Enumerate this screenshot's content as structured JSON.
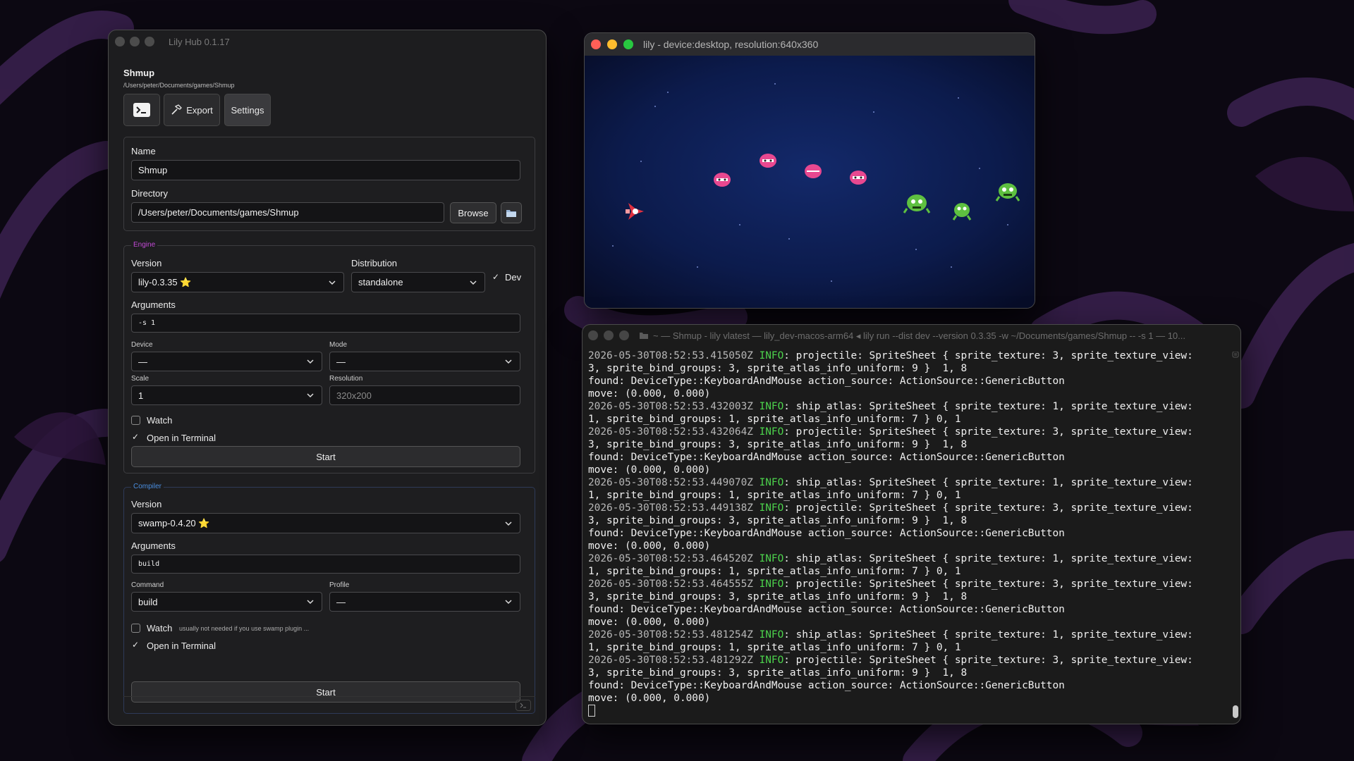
{
  "hub": {
    "title": "Lily Hub 0.1.17",
    "project_name": "Shmup",
    "project_path": "/Users/peter/Documents/games/Shmup",
    "terminal_icon": "terminal-icon",
    "export_label": "Export",
    "settings_label": "Settings",
    "general": {
      "name_label": "Name",
      "name_value": "Shmup",
      "directory_label": "Directory",
      "directory_value": "/Users/peter/Documents/games/Shmup",
      "browse_label": "Browse"
    },
    "engine": {
      "legend": "Engine",
      "legend_color": "#c34ad6",
      "version_label": "Version",
      "version_value": "lily-0.3.35 ⭐",
      "distribution_label": "Distribution",
      "distribution_value": "standalone",
      "dev_label": "Dev",
      "dev_checked": true,
      "arguments_label": "Arguments",
      "arguments_value": "-s 1",
      "device_label": "Device",
      "device_value": "—",
      "mode_label": "Mode",
      "mode_value": "—",
      "scale_label": "Scale",
      "scale_value": "1",
      "resolution_label": "Resolution",
      "resolution_placeholder": "320x200",
      "watch_label": "Watch",
      "watch_checked": false,
      "open_terminal_label": "Open in Terminal",
      "open_terminal_checked": true,
      "start_label": "Start"
    },
    "compiler": {
      "legend": "Compiler",
      "legend_color": "#4a8ee0",
      "version_label": "Version",
      "version_value": "swamp-0.4.20 ⭐",
      "arguments_label": "Arguments",
      "arguments_value": "build",
      "command_label": "Command",
      "command_value": "build",
      "profile_label": "Profile",
      "profile_value": "—",
      "watch_label": "Watch",
      "watch_hint": "usually not needed if you use swamp plugin ...",
      "watch_checked": false,
      "open_terminal_label": "Open in Terminal",
      "open_terminal_checked": true,
      "start_label": "Start"
    },
    "footer_icon": "terminal-small-icon"
  },
  "game": {
    "title": "lily - device:desktop, resolution:640x360",
    "background_color": "#0a1030",
    "player_color": "#e03040",
    "enemy_red_color": "#e84890",
    "enemy_green_color": "#5ec040"
  },
  "terminal": {
    "title": "~ — Shmup - lily vlatest — lily_dev-macos-arm64 ◂ lily run --dist dev --version 0.3.35 -w ~/Documents/games/Shmup -- -s 1 — 10...",
    "log": [
      {
        "ts": "2026-05-30T08:52:53.415050Z",
        "level": "INFO",
        "msg": ": projectile: SpriteSheet { sprite_texture: 3, sprite_texture_view:"
      },
      {
        "text": "3, sprite_bind_groups: 3, sprite_atlas_info_uniform: 9 }  1, 8"
      },
      {
        "text": "found: DeviceType::KeyboardAndMouse action_source: ActionSource::GenericButton"
      },
      {
        "text": "move: (0.000, 0.000)"
      },
      {
        "ts": "2026-05-30T08:52:53.432003Z",
        "level": "INFO",
        "msg": ": ship_atlas: SpriteSheet { sprite_texture: 1, sprite_texture_view:"
      },
      {
        "text": "1, sprite_bind_groups: 1, sprite_atlas_info_uniform: 7 } 0, 1"
      },
      {
        "ts": "2026-05-30T08:52:53.432064Z",
        "level": "INFO",
        "msg": ": projectile: SpriteSheet { sprite_texture: 3, sprite_texture_view:"
      },
      {
        "text": "3, sprite_bind_groups: 3, sprite_atlas_info_uniform: 9 }  1, 8"
      },
      {
        "text": "found: DeviceType::KeyboardAndMouse action_source: ActionSource::GenericButton"
      },
      {
        "text": "move: (0.000, 0.000)"
      },
      {
        "ts": "2026-05-30T08:52:53.449070Z",
        "level": "INFO",
        "msg": ": ship_atlas: SpriteSheet { sprite_texture: 1, sprite_texture_view:"
      },
      {
        "text": "1, sprite_bind_groups: 1, sprite_atlas_info_uniform: 7 } 0, 1"
      },
      {
        "ts": "2026-05-30T08:52:53.449138Z",
        "level": "INFO",
        "msg": ": projectile: SpriteSheet { sprite_texture: 3, sprite_texture_view:"
      },
      {
        "text": "3, sprite_bind_groups: 3, sprite_atlas_info_uniform: 9 }  1, 8"
      },
      {
        "text": "found: DeviceType::KeyboardAndMouse action_source: ActionSource::GenericButton"
      },
      {
        "text": "move: (0.000, 0.000)"
      },
      {
        "ts": "2026-05-30T08:52:53.464520Z",
        "level": "INFO",
        "msg": ": ship_atlas: SpriteSheet { sprite_texture: 1, sprite_texture_view:"
      },
      {
        "text": "1, sprite_bind_groups: 1, sprite_atlas_info_uniform: 7 } 0, 1"
      },
      {
        "ts": "2026-05-30T08:52:53.464555Z",
        "level": "INFO",
        "msg": ": projectile: SpriteSheet { sprite_texture: 3, sprite_texture_view:"
      },
      {
        "text": "3, sprite_bind_groups: 3, sprite_atlas_info_uniform: 9 }  1, 8"
      },
      {
        "text": "found: DeviceType::KeyboardAndMouse action_source: ActionSource::GenericButton"
      },
      {
        "text": "move: (0.000, 0.000)"
      },
      {
        "ts": "2026-05-30T08:52:53.481254Z",
        "level": "INFO",
        "msg": ": ship_atlas: SpriteSheet { sprite_texture: 1, sprite_texture_view:"
      },
      {
        "text": "1, sprite_bind_groups: 1, sprite_atlas_info_uniform: 7 } 0, 1"
      },
      {
        "ts": "2026-05-30T08:52:53.481292Z",
        "level": "INFO",
        "msg": ": projectile: SpriteSheet { sprite_texture: 3, sprite_texture_view:"
      },
      {
        "text": "3, sprite_bind_groups: 3, sprite_atlas_info_uniform: 9 }  1, 8"
      },
      {
        "text": "found: DeviceType::KeyboardAndMouse action_source: ActionSource::GenericButton"
      },
      {
        "text": "move: (0.000, 0.000)"
      }
    ]
  },
  "colors": {
    "desktop_background": "#0c0812",
    "wallpaper_purple": "#3b2150",
    "info_green": "#4cd34c"
  }
}
